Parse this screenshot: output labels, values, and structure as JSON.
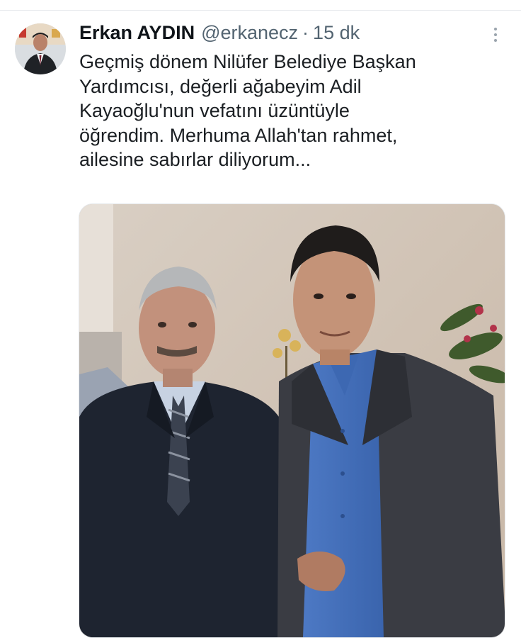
{
  "author": {
    "display_name": "Erkan AYDIN",
    "handle": "@erkanecz",
    "separator": "·",
    "time": "15 dk"
  },
  "tweet": {
    "text": "Geçmiş dönem Nilüfer Belediye Başkan\nYardımcısı, değerli ağabeyim Adil\nKayaoğlu'nun vefatını üzüntüyle\nöğrendim. Merhuma Allah'tan rahmet,\nailesine sabırlar diliyorum..."
  },
  "icons": {
    "more": "more-vertical-icon"
  },
  "colors": {
    "text_primary": "#0f1419",
    "text_secondary": "#536471",
    "divider": "#e6e9ec"
  }
}
